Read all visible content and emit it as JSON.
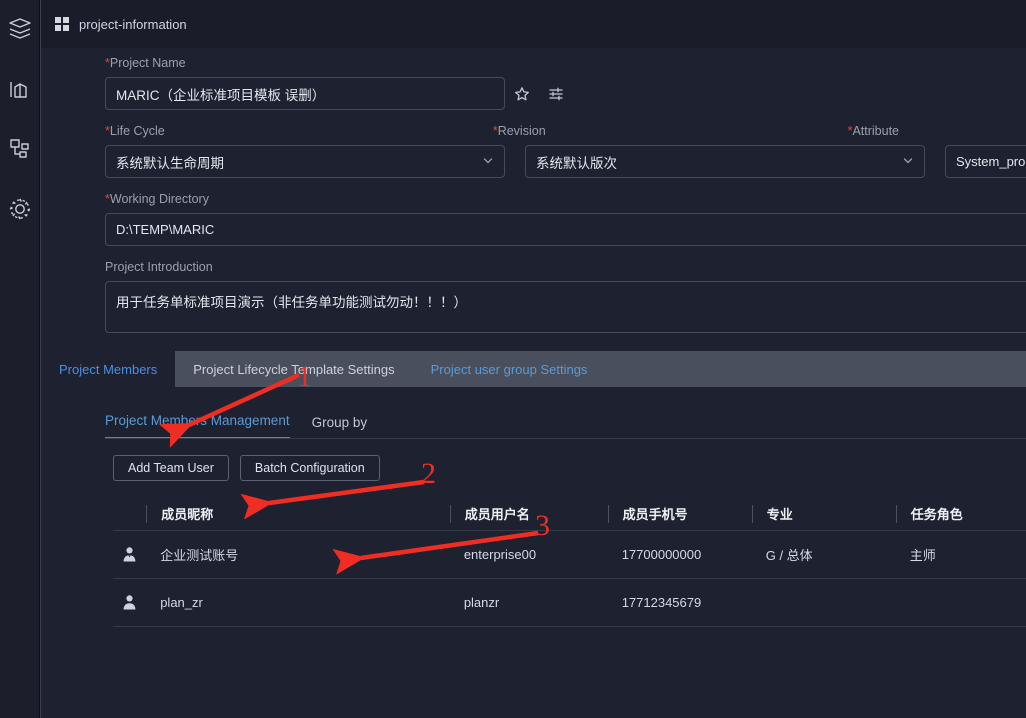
{
  "sidebar": {
    "items": [
      {
        "name": "layers-icon",
        "label": "Layers"
      },
      {
        "name": "chart-icon",
        "label": "Statistics"
      },
      {
        "name": "hierarchy-icon",
        "label": "Structure"
      },
      {
        "name": "gear-icon",
        "label": "Settings"
      }
    ]
  },
  "header": {
    "icon": "grid-icon",
    "title": "project-information"
  },
  "form": {
    "project_name": {
      "label": "Project Name",
      "required": true,
      "value": "MARIC（企业标准项目模板 误删）",
      "star_icon": "star-icon",
      "settings_icon": "sliders-icon"
    },
    "life_cycle": {
      "label": "Life Cycle",
      "required": true,
      "value": "系统默认生命周期"
    },
    "revision": {
      "label": "Revision",
      "required": true,
      "value": "系统默认版次"
    },
    "attribute": {
      "label": "Attribute",
      "required": true,
      "value": "System_propert"
    },
    "working_directory": {
      "label": "Working Directory",
      "required": true,
      "value": "D:\\TEMP\\MARIC"
    },
    "project_introduction": {
      "label": "Project Introduction",
      "required": false,
      "value": "用于任务单标准项目演示（非任务单功能测试勿动！！！）"
    }
  },
  "tabs_outer": [
    {
      "label": "Project Members",
      "active": true
    },
    {
      "label": "Project Lifecycle Template Settings",
      "active": false
    },
    {
      "label": "Project user group Settings",
      "active": false,
      "link": true
    }
  ],
  "tabs_inner": [
    {
      "label": "Project Members Management",
      "active": true
    },
    {
      "label": "Group by",
      "active": false
    }
  ],
  "toolbar": {
    "add_team_user": "Add Team User",
    "batch_configuration": "Batch Configuration"
  },
  "table": {
    "columns": [
      "成员昵称",
      "成员用户名",
      "成员手机号",
      "专业",
      "任务角色"
    ],
    "rows": [
      {
        "avatar": "user-filled-icon",
        "nickname": "企业测试账号",
        "username": "enterprise00",
        "phone": "17700000000",
        "major": "G / 总体",
        "role": "主师"
      },
      {
        "avatar": "user-plain-icon",
        "nickname": "plan_zr",
        "username": "planzr",
        "phone": "17712345679",
        "major": "",
        "role": ""
      }
    ]
  },
  "annotations": {
    "color": "#f02d23",
    "markers": [
      {
        "number": "1",
        "target": "project-members-tab"
      },
      {
        "number": "2",
        "target": "project-members-management-tab"
      },
      {
        "number": "3",
        "target": "batch-configuration-button"
      }
    ]
  }
}
